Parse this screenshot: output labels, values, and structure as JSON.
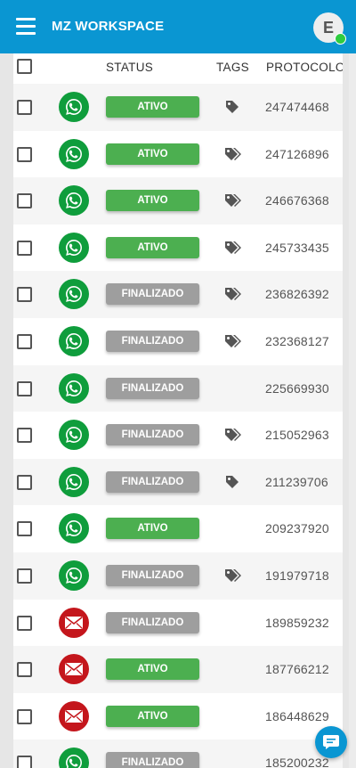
{
  "app": {
    "title": "MZ WORKSPACE",
    "user_initial": "E",
    "accent_color": "#0a96d2",
    "online_color": "#2ecc40"
  },
  "table": {
    "headers": {
      "status": "STATUS",
      "tags": "TAGS",
      "protocolo": "PROTOCOLO"
    },
    "rows": [
      {
        "channel": "whatsapp",
        "status": "ativo",
        "status_label": "Ativo",
        "tags": "single",
        "protocolo": "247474468"
      },
      {
        "channel": "whatsapp",
        "status": "ativo",
        "status_label": "Ativo",
        "tags": "multiple",
        "protocolo": "247126896"
      },
      {
        "channel": "whatsapp",
        "status": "ativo",
        "status_label": "Ativo",
        "tags": "multiple",
        "protocolo": "246676368"
      },
      {
        "channel": "whatsapp",
        "status": "ativo",
        "status_label": "Ativo",
        "tags": "multiple",
        "protocolo": "245733435"
      },
      {
        "channel": "whatsapp",
        "status": "finalizado",
        "status_label": "Finalizado",
        "tags": "multiple",
        "protocolo": "236826392"
      },
      {
        "channel": "whatsapp",
        "status": "finalizado",
        "status_label": "Finalizado",
        "tags": "multiple",
        "protocolo": "232368127"
      },
      {
        "channel": "whatsapp",
        "status": "finalizado",
        "status_label": "Finalizado",
        "tags": "none",
        "protocolo": "225669930"
      },
      {
        "channel": "whatsapp",
        "status": "finalizado",
        "status_label": "Finalizado",
        "tags": "multiple",
        "protocolo": "215052963"
      },
      {
        "channel": "whatsapp",
        "status": "finalizado",
        "status_label": "Finalizado",
        "tags": "single",
        "protocolo": "211239706"
      },
      {
        "channel": "whatsapp",
        "status": "ativo",
        "status_label": "Ativo",
        "tags": "none",
        "protocolo": "209237920"
      },
      {
        "channel": "whatsapp",
        "status": "finalizado",
        "status_label": "Finalizado",
        "tags": "multiple",
        "protocolo": "191979718"
      },
      {
        "channel": "email",
        "status": "finalizado",
        "status_label": "Finalizado",
        "tags": "none",
        "protocolo": "189859232"
      },
      {
        "channel": "email",
        "status": "ativo",
        "status_label": "Ativo",
        "tags": "none",
        "protocolo": "187766212"
      },
      {
        "channel": "email",
        "status": "ativo",
        "status_label": "Ativo",
        "tags": "none",
        "protocolo": "186448629"
      },
      {
        "channel": "whatsapp",
        "status": "finalizado",
        "status_label": "Finalizado",
        "tags": "none",
        "protocolo": "185200232"
      }
    ]
  },
  "colors": {
    "ativo": "#4caf50",
    "finalizado": "#9e9e9e",
    "whatsapp": "#0f9d3c",
    "email": "#c4161c"
  },
  "icons": {
    "menu": "menu-icon",
    "whatsapp": "whatsapp-icon",
    "email": "envelope-icon",
    "tag_single": "tag-icon",
    "tag_multiple": "tags-icon",
    "chat": "chat-icon"
  }
}
